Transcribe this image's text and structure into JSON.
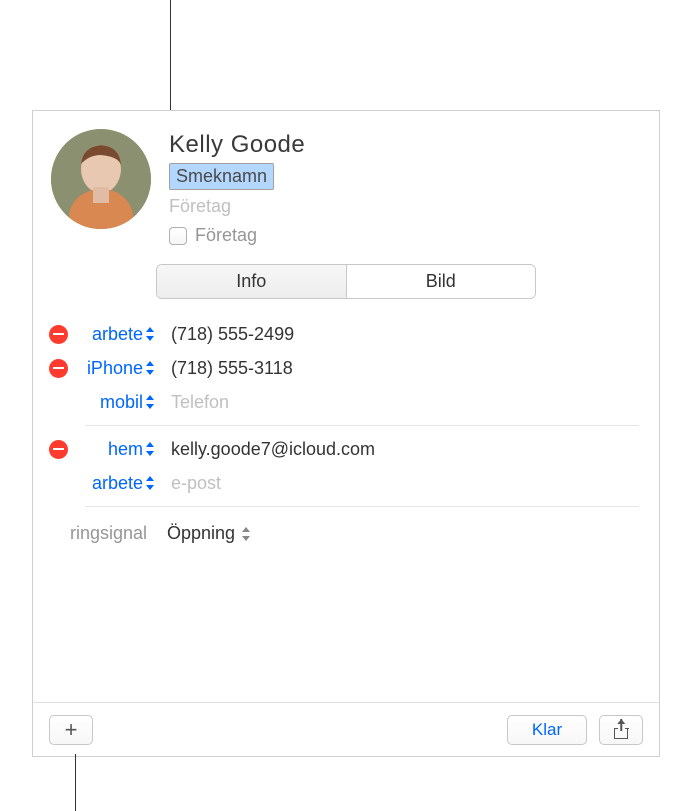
{
  "contact": {
    "first_name": "Kelly",
    "last_name": "Goode",
    "full_name": "Kelly  Goode",
    "nickname_placeholder": "Smeknamn",
    "company_placeholder": "Företag",
    "company_checkbox_label": "Företag"
  },
  "tabs": {
    "info": "Info",
    "picture": "Bild"
  },
  "phones": [
    {
      "label": "arbete",
      "value": "(718) 555-2499",
      "removable": true
    },
    {
      "label": "iPhone",
      "value": "(718) 555-3118",
      "removable": true
    },
    {
      "label": "mobil",
      "placeholder": "Telefon",
      "removable": false
    }
  ],
  "emails": [
    {
      "label": "hem",
      "value": "kelly.goode7@icloud.com",
      "removable": true
    },
    {
      "label": "arbete",
      "placeholder": "e-post",
      "removable": false
    }
  ],
  "ringtone": {
    "label": "ringsignal",
    "value": "Öppning"
  },
  "footer": {
    "done": "Klar"
  }
}
